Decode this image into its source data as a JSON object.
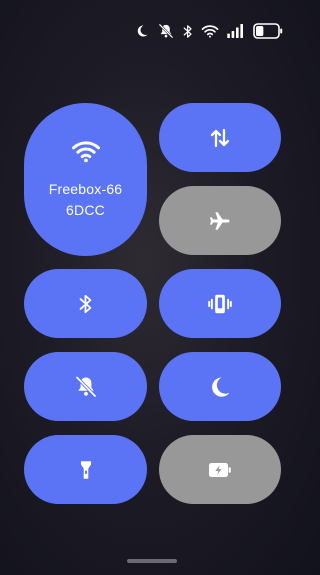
{
  "status_bar": {
    "icons": [
      "moon-icon",
      "silent-icon",
      "bluetooth-icon",
      "wifi-icon",
      "signal-icon",
      "battery-icon"
    ],
    "battery_level": 0.35
  },
  "tiles": {
    "wifi": {
      "line1": "Freebox-66",
      "line2": "6DCC",
      "state": "on",
      "icon": "wifi-icon"
    },
    "mobile_data": {
      "state": "on",
      "icon": "data-transfer-icon"
    },
    "airplane_mode": {
      "state": "off",
      "icon": "airplane-icon"
    },
    "bluetooth": {
      "state": "on",
      "icon": "bluetooth-icon"
    },
    "vibrate": {
      "state": "on",
      "icon": "vibrate-icon"
    },
    "silent": {
      "state": "on",
      "icon": "bell-off-icon"
    },
    "do_not_disturb": {
      "state": "on",
      "icon": "moon-icon"
    },
    "flashlight": {
      "state": "on",
      "icon": "flashlight-icon"
    },
    "battery_saver": {
      "state": "off",
      "icon": "battery-saver-icon"
    }
  },
  "colors": {
    "active_tile": "#5a74f5",
    "inactive_tile": "#989898",
    "background": "#1d1b26",
    "icon": "#ffffff"
  }
}
